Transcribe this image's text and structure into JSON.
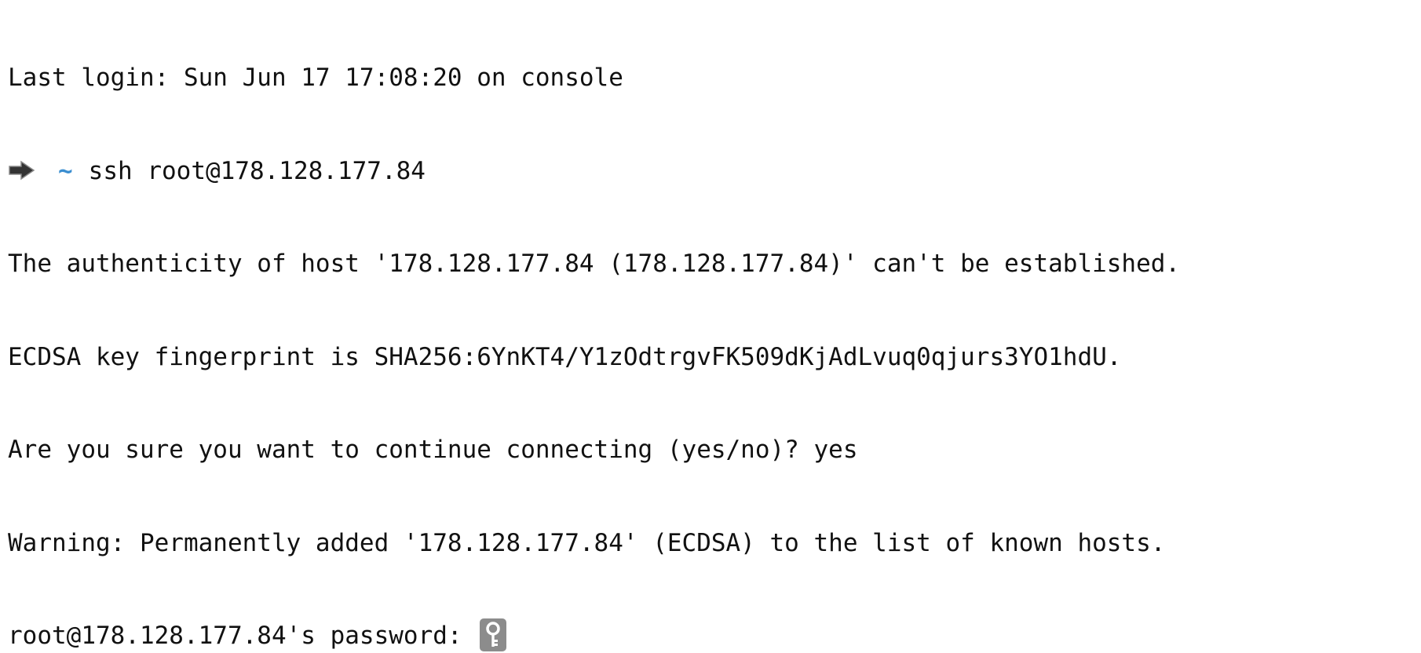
{
  "terminal": {
    "lines": {
      "last_login": "Last login: Sun Jun 17 17:08:20 on console",
      "prompt_dir": "~",
      "command": "ssh root@178.128.177.84",
      "authenticity": "The authenticity of host '178.128.177.84 (178.128.177.84)' can't be established.",
      "fingerprint": "ECDSA key fingerprint is SHA256:6YnKT4/Y1zOdtrgvFK509dKjAdLvuq0qjurs3YO1hdU.",
      "confirm_question": "Are you sure you want to continue connecting (yes/no)? yes",
      "warning": "Warning: Permanently added '178.128.177.84' (ECDSA) to the list of known hosts.",
      "password_prompt": "root@178.128.177.84's password: "
    },
    "colors": {
      "text": "#111111",
      "tilde": "#3b8ed0",
      "key_badge": "#8c8c8c",
      "background": "#ffffff"
    },
    "icons": {
      "prompt": "arrow-right-icon",
      "password": "key-icon"
    }
  }
}
